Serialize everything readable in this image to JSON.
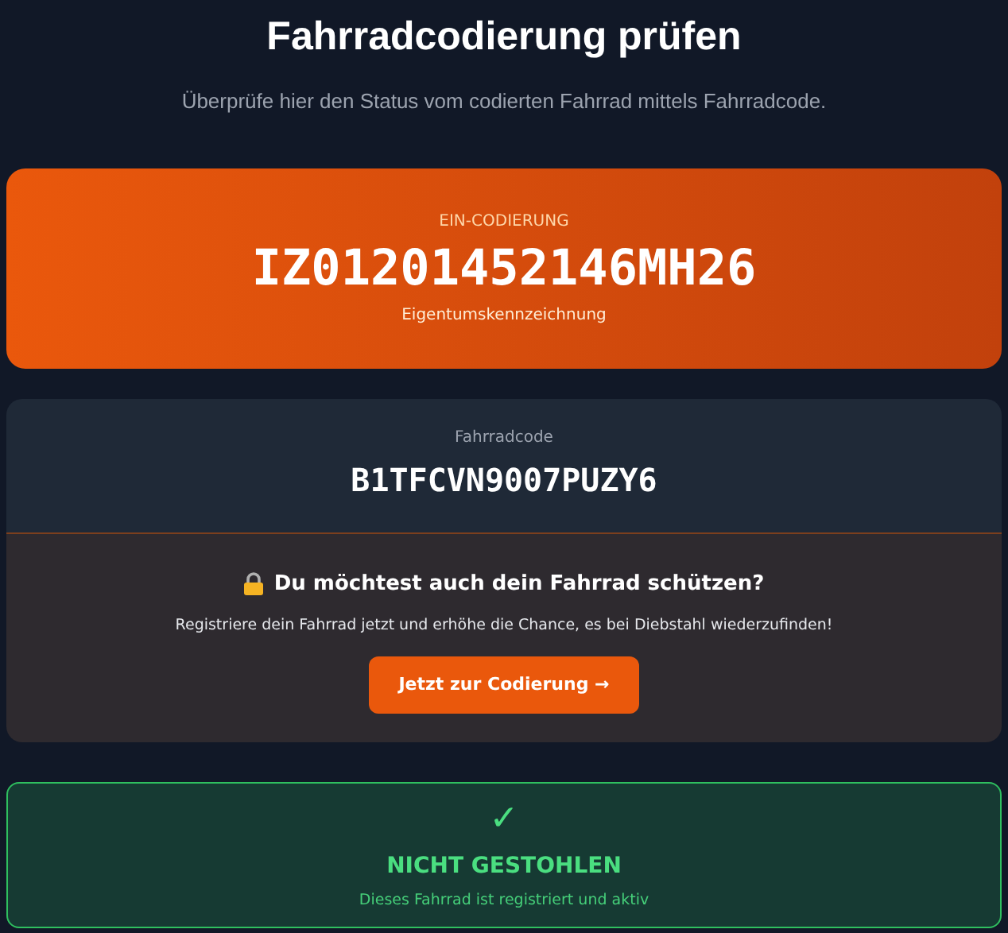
{
  "header": {
    "title": "Fahrradcodierung prüfen",
    "subtitle": "Überprüfe hier den Status vom codierten Fahrrad mittels Fahrradcode."
  },
  "engraving": {
    "label": "EIN-CODIERUNG",
    "code": "IZ01201452146MH26",
    "caption": "Eigentumskennzeichnung"
  },
  "bike_code": {
    "label": "Fahrradcode",
    "code": "B1TFCVN9007PUZY6"
  },
  "promo": {
    "heading": "Du möchtest auch dein Fahrrad schützen?",
    "text": "Registriere dein Fahrrad jetzt und erhöhe die Chance, es bei Diebstahl wiederzufinden!",
    "button": "Jetzt zur Codierung →"
  },
  "status": {
    "kind": "ok",
    "symbol": "✓",
    "title": "NICHT GESTOHLEN",
    "text": "Dieses Fahrrad ist registriert und aktiv"
  }
}
